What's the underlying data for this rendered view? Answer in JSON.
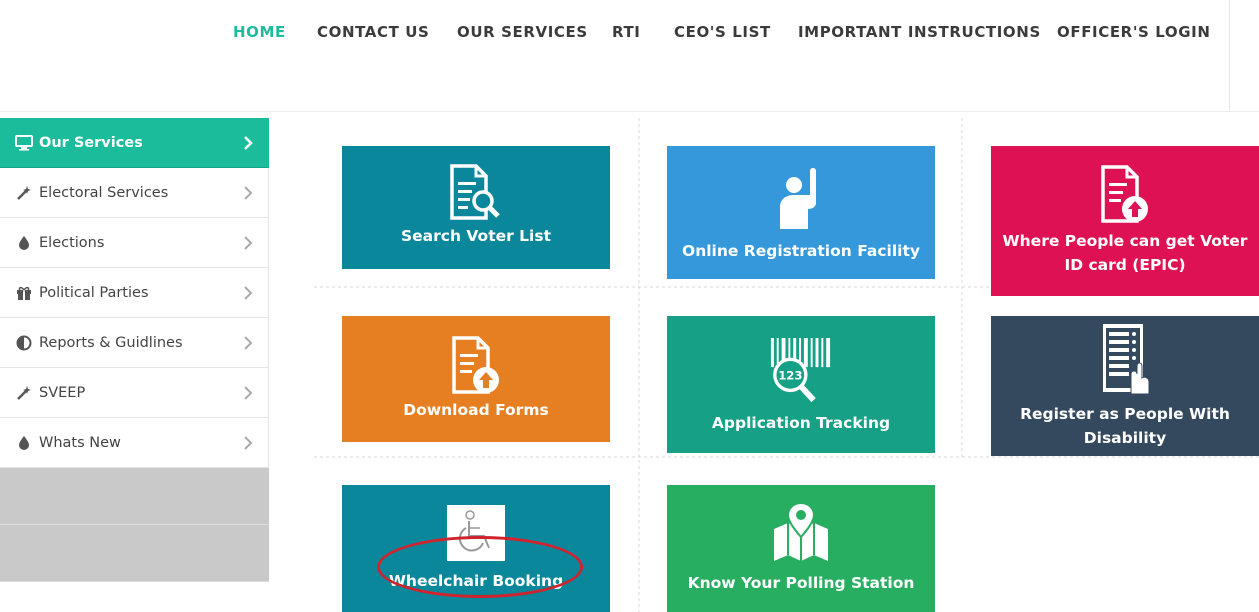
{
  "nav": {
    "items": [
      "HOME",
      "CONTACT US",
      "OUR SERVICES",
      "RTI",
      "CEO'S LIST",
      "IMPORTANT INSTRUCTIONS",
      "OFFICER'S LOGIN"
    ],
    "active": "HOME",
    "active_color": "#1cbc9c"
  },
  "sidebar": {
    "items": [
      {
        "label": "Our Services",
        "icon": "monitor-icon",
        "active": true
      },
      {
        "label": "Electoral Services",
        "icon": "magic-wand-icon"
      },
      {
        "label": "Elections",
        "icon": "droplet-icon"
      },
      {
        "label": "Political Parties",
        "icon": "gift-icon"
      },
      {
        "label": "Reports & Guidlines",
        "icon": "half-circle-icon"
      },
      {
        "label": "SVEEP",
        "icon": "magic-wand-icon"
      },
      {
        "label": "Whats New",
        "icon": "droplet-icon"
      }
    ],
    "active_color": "#1bbc9b"
  },
  "tiles": [
    {
      "label": "Search Voter List",
      "icon": "document-search-icon",
      "color": "#0a879b"
    },
    {
      "label": "Online Registration Facility",
      "icon": "raised-hand-person-icon",
      "color": "#3498db"
    },
    {
      "label": "Where People can get Voter ID card (EPIC)",
      "icon": "document-upload-icon",
      "color": "#df1155"
    },
    {
      "label": "Download Forms",
      "icon": "document-upload-icon",
      "color": "#e67e22"
    },
    {
      "label": "Application Tracking",
      "icon": "barcode-magnifier-icon",
      "color": "#16a085"
    },
    {
      "label": "Register as People With Disability",
      "icon": "voting-machine-icon",
      "color": "#34495e"
    },
    {
      "label": "Wheelchair Booking",
      "icon": "wheelchair-icon",
      "color": "#0a879b"
    },
    {
      "label": "Know Your Polling Station",
      "icon": "map-pin-icon",
      "color": "#27ae60"
    }
  ]
}
